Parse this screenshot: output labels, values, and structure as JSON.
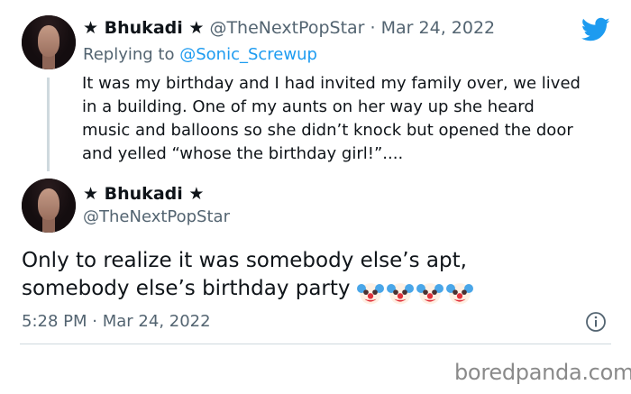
{
  "reply_tweet": {
    "display_name": "★ Bhukadi ★",
    "handle": "@TheNextPopStar",
    "separator": "·",
    "date": "Mar 24, 2022",
    "replying_prefix": "Replying to",
    "replying_to": "@Sonic_Screwup",
    "text_lines": [
      "It was my birthday and I had invited my family over, we lived",
      "in a building. One of my aunts on her way up she heard",
      "music and balloons so she didn’t knock but opened the door",
      "and yelled “whose the birthday girl!”...."
    ]
  },
  "main_tweet": {
    "display_name": "★ Bhukadi ★",
    "handle": "@TheNextPopStar",
    "text_lines": [
      "Only to realize it was somebody else’s apt,",
      "somebody else’s birthday party"
    ],
    "emoji": [
      "clown-face",
      "clown-face",
      "clown-face",
      "clown-face"
    ],
    "time": "5:28 PM",
    "separator": "·",
    "date": "Mar 24, 2022"
  },
  "icons": {
    "brand": "twitter-bird-icon",
    "info": "info-icon",
    "brand_color": "#1d9bf0"
  },
  "watermark": "boredpanda.com"
}
